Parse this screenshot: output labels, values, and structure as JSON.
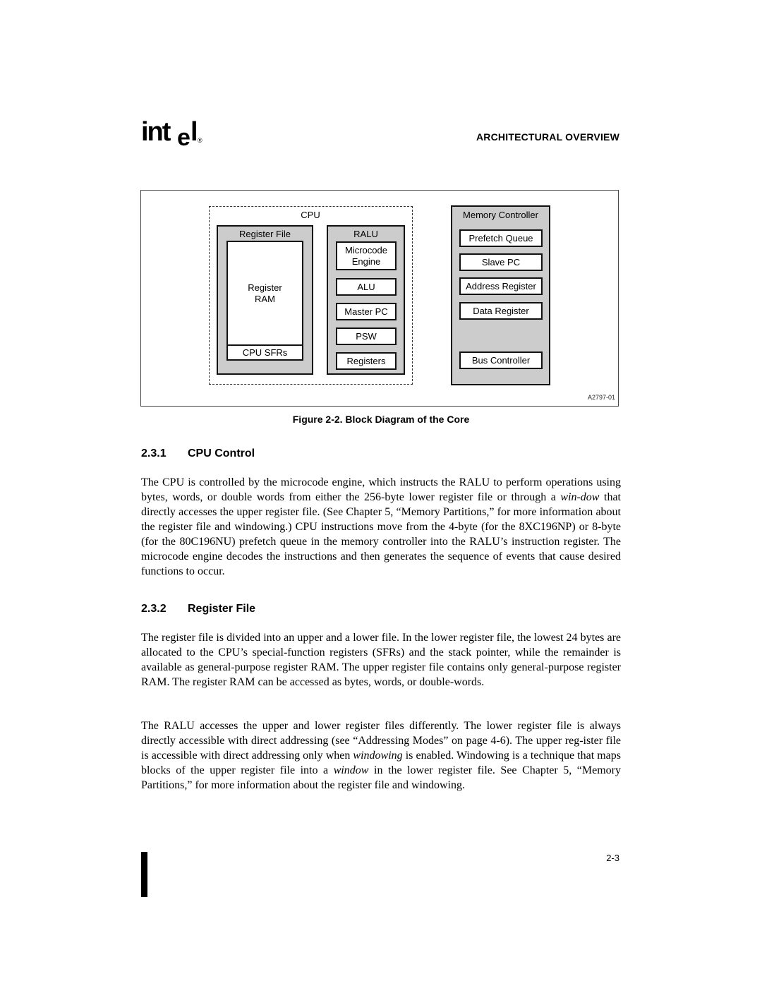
{
  "header": {
    "logo": "intel",
    "logo_parts": {
      "int": "int",
      "e": "e",
      "l": "l",
      "reg": "®"
    },
    "section_title": "ARCHITECTURAL OVERVIEW"
  },
  "figure": {
    "cpu_label": "CPU",
    "register_file": {
      "title": "Register File",
      "ram_label": "Register RAM",
      "sfrs_label": "CPU SFRs"
    },
    "ralu": {
      "title": "RALU",
      "blocks": [
        "Microcode Engine",
        "ALU",
        "Master PC",
        "PSW",
        "Registers"
      ]
    },
    "memory_controller": {
      "title": "Memory Controller",
      "blocks": [
        "Prefetch Queue",
        "Slave PC",
        "Address Register",
        "Data Register"
      ],
      "bus_controller": "Bus Controller"
    },
    "figure_id": "A2797-01",
    "caption": "Figure 2-2.  Block Diagram of the Core"
  },
  "sections": [
    {
      "number": "2.3.1",
      "title": "CPU Control",
      "paragraphs": [
        {
          "parts": [
            {
              "text": "The CPU is controlled by the microcode engine, which instructs the RALU to perform operations using bytes, words, or double words from either the 256-byte lower register file or through a ",
              "italic": false
            },
            {
              "text": "win-dow",
              "italic": true
            },
            {
              "text": " that directly accesses the upper register file. (See  Chapter 5, “Memory Partitions,” for more information about the register file and windowing.) CPU instructions move from the 4-byte (for the 8XC196NP) or 8-byte (for the 80C196NU) prefetch queue in the memory controller into the RALU’s instruction register. The microcode engine decodes the instructions and then generates the sequence of events that cause desired functions to occur.",
              "italic": false
            }
          ]
        }
      ]
    },
    {
      "number": "2.3.2",
      "title": "Register File",
      "paragraphs": [
        {
          "parts": [
            {
              "text": "The register file is divided into an upper and a lower file. In the lower register file, the lowest 24 bytes are allocated to the CPU’s special-function registers (SFRs) and the stack pointer, while the remainder is available as general-purpose register RAM. The upper register file contains only general-purpose register RAM. The register RAM can be accessed as bytes, words, or double-words.",
              "italic": false
            }
          ]
        },
        {
          "parts": [
            {
              "text": "The RALU accesses the upper and lower register files differently. The lower register file is always directly accessible with direct addressing (see “Addressing Modes” on page 4-6). The upper reg-ister file is accessible with direct addressing only when ",
              "italic": false
            },
            {
              "text": "windowing",
              "italic": true
            },
            {
              "text": " is enabled. Windowing is a technique that maps blocks of the upper register file into a ",
              "italic": false
            },
            {
              "text": "window",
              "italic": true
            },
            {
              "text": " in the lower register file. See  Chapter 5, “Memory Partitions,” for more information about the register file and windowing.",
              "italic": false
            }
          ]
        }
      ]
    }
  ],
  "footer": {
    "page_number": "2-3"
  }
}
